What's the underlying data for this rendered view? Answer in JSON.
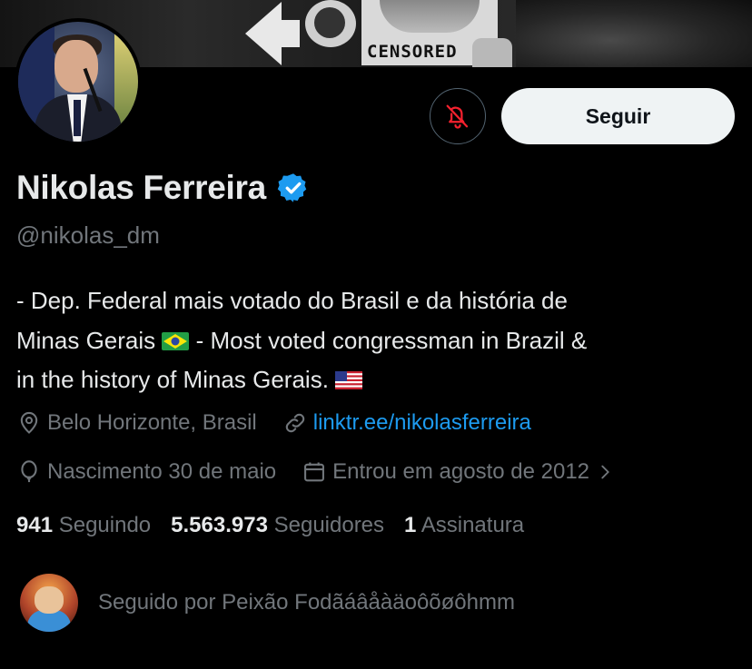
{
  "banner": {
    "sign_text": "CENSORED"
  },
  "profile": {
    "name": "Nikolas Ferreira",
    "handle": "@nikolas_dm",
    "verified_color": "#1d9bf0"
  },
  "actions": {
    "mute_icon": "muted-bell-icon",
    "mute_color": "#f4212e",
    "follow_label": "Seguir"
  },
  "bio": {
    "line1": "- Dep. Federal mais votado do Brasil e da história de",
    "line2_a": "Minas Gerais",
    "line2_b": "- Most voted congressman in Brazil &",
    "line3": "in the history of Minas Gerais."
  },
  "meta": {
    "location": "Belo Horizonte, Brasil",
    "link": "linktr.ee/nikolasferreira",
    "birthday": "Nascimento 30 de maio",
    "joined": "Entrou em agosto de 2012"
  },
  "stats": {
    "following_count": "941",
    "following_label": "Seguindo",
    "followers_count": "5.563.973",
    "followers_label": "Seguidores",
    "subs_count": "1",
    "subs_label": "Assinatura"
  },
  "followed_by": {
    "text": "Seguido por Peixão Fodãáâåàäoôõøôhmm"
  }
}
